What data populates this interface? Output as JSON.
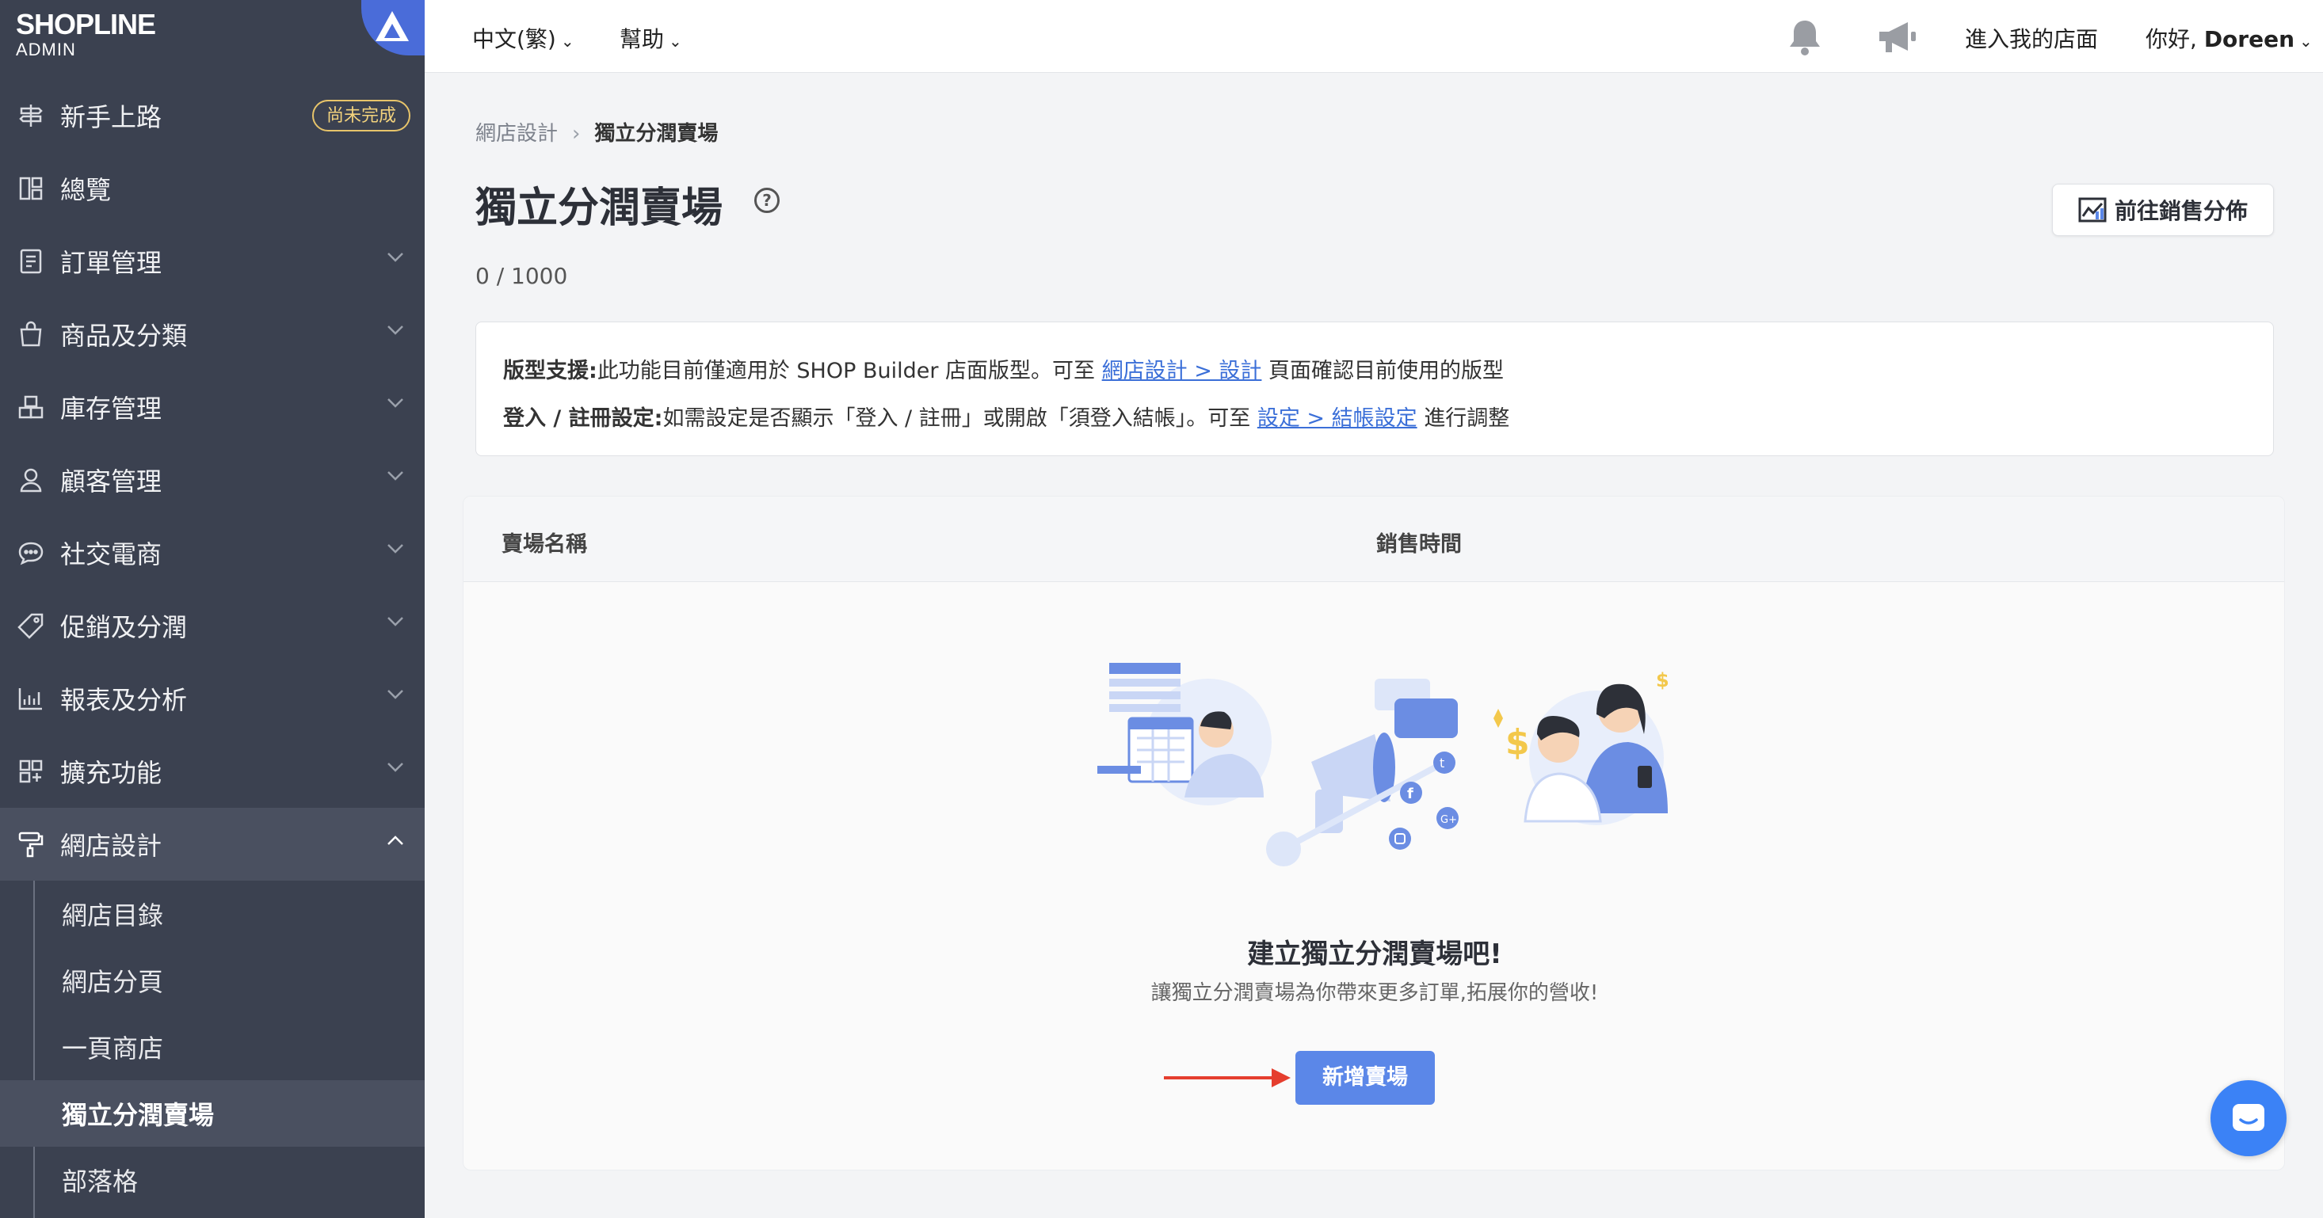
{
  "brand": {
    "logo": "SHOPLINE",
    "sub": "ADMIN"
  },
  "sidebar": {
    "items": [
      {
        "label": "新手上路",
        "icon": "signpost-icon",
        "badge": "尚未完成"
      },
      {
        "label": "總覽",
        "icon": "dashboard-icon"
      },
      {
        "label": "訂單管理",
        "icon": "order-icon"
      },
      {
        "label": "商品及分類",
        "icon": "bag-icon"
      },
      {
        "label": "庫存管理",
        "icon": "inventory-icon"
      },
      {
        "label": "顧客管理",
        "icon": "customer-icon"
      },
      {
        "label": "社交電商",
        "icon": "chat-bubble-icon"
      },
      {
        "label": "促銷及分潤",
        "icon": "tag-icon"
      },
      {
        "label": "報表及分析",
        "icon": "chart-icon"
      },
      {
        "label": "擴充功能",
        "icon": "apps-icon"
      },
      {
        "label": "網店設計",
        "icon": "paint-roller-icon"
      }
    ],
    "sub_items": [
      "網店目錄",
      "網店分頁",
      "一頁商店",
      "獨立分潤賣場",
      "部落格"
    ]
  },
  "topbar": {
    "language": "中文(繁)",
    "help": "幫助",
    "enter_store": "進入我的店面",
    "greeting": "你好,",
    "user": "Doreen"
  },
  "page": {
    "breadcrumb_parent": "網店設計",
    "breadcrumb_current": "獨立分潤賣場",
    "title": "獨立分潤賣場",
    "counter": "0 / 1000",
    "sales_button": "前往銷售分佈"
  },
  "info": {
    "line1_label": "版型支援:",
    "line1_text": "此功能目前僅適用於 SHOP Builder 店面版型。可至",
    "line1_link": "網店設計 > 設計",
    "line1_tail": "頁面確認目前使用的版型",
    "line2_label": "登入 / 註冊設定:",
    "line2_text": "如需設定是否顯示「登入 / 註冊」或開啟「須登入結帳」。可至",
    "line2_link": "設定 > 結帳設定",
    "line2_tail": "進行調整"
  },
  "table": {
    "col_name": "賣場名稱",
    "col_time": "銷售時間"
  },
  "empty": {
    "title": "建立獨立分潤賣場吧!",
    "subtitle": "讓獨立分潤賣場為你帶來更多訂單,拓展你的營收!",
    "button": "新增賣場"
  },
  "colors": {
    "sidebar": "#3b4150",
    "primary": "#5b87e8",
    "link": "#3b6fd8",
    "arrow": "#e53e2e"
  }
}
